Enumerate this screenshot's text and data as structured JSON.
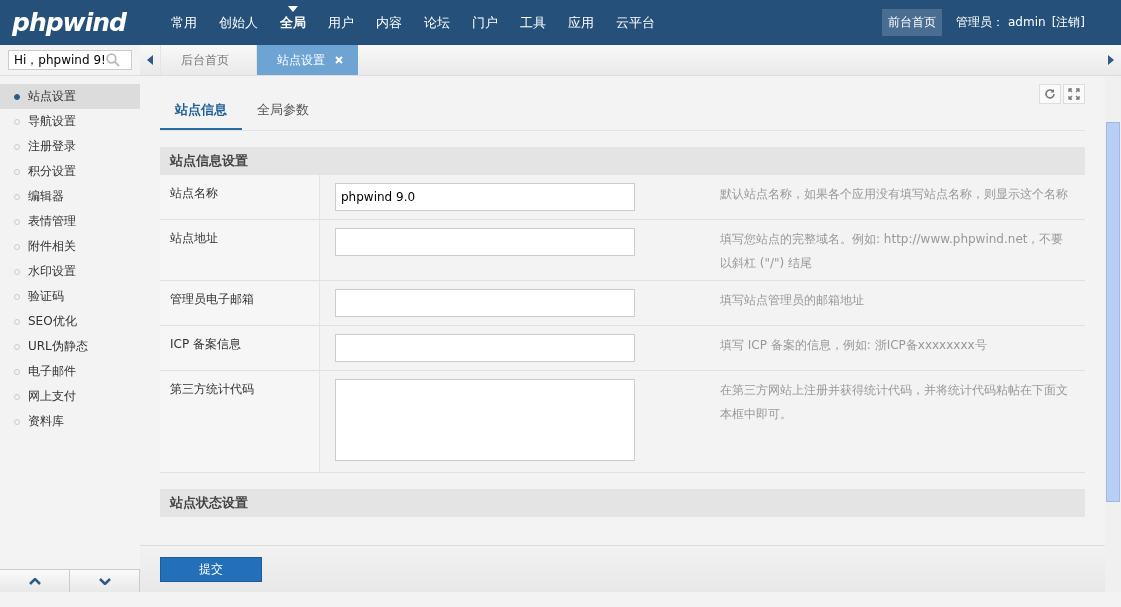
{
  "header": {
    "logo": "phpwind",
    "nav": [
      {
        "label": "常用",
        "selected": false
      },
      {
        "label": "创始人",
        "selected": false
      },
      {
        "label": "全局",
        "selected": true
      },
      {
        "label": "用户",
        "selected": false
      },
      {
        "label": "内容",
        "selected": false
      },
      {
        "label": "论坛",
        "selected": false
      },
      {
        "label": "门户",
        "selected": false
      },
      {
        "label": "工具",
        "selected": false
      },
      {
        "label": "应用",
        "selected": false
      },
      {
        "label": "云平台",
        "selected": false
      }
    ],
    "front_link": "前台首页",
    "admin_label": "管理员：",
    "admin_name": "admin",
    "logout": "[注销]"
  },
  "search": {
    "value": "Hi，phpwind 9!"
  },
  "page_tabs": [
    {
      "label": "后台首页",
      "selected": false,
      "closable": false
    },
    {
      "label": "站点设置",
      "selected": true,
      "closable": true
    }
  ],
  "sidebar": {
    "items": [
      {
        "label": "站点设置",
        "selected": true
      },
      {
        "label": "导航设置",
        "selected": false
      },
      {
        "label": "注册登录",
        "selected": false
      },
      {
        "label": "积分设置",
        "selected": false
      },
      {
        "label": "编辑器",
        "selected": false
      },
      {
        "label": "表情管理",
        "selected": false
      },
      {
        "label": "附件相关",
        "selected": false
      },
      {
        "label": "水印设置",
        "selected": false
      },
      {
        "label": "验证码",
        "selected": false
      },
      {
        "label": "SEO优化",
        "selected": false
      },
      {
        "label": "URL伪静态",
        "selected": false
      },
      {
        "label": "电子邮件",
        "selected": false
      },
      {
        "label": "网上支付",
        "selected": false
      },
      {
        "label": "资料库",
        "selected": false
      }
    ]
  },
  "content_tabs": [
    {
      "label": "站点信息",
      "selected": true
    },
    {
      "label": "全局参数",
      "selected": false
    }
  ],
  "sections": [
    {
      "title": "站点信息设置",
      "rows": [
        {
          "label": "站点名称",
          "kind": "input",
          "value": "phpwind 9.0",
          "hint": "默认站点名称，如果各个应用没有填写站点名称，则显示这个名称"
        },
        {
          "label": "站点地址",
          "kind": "input",
          "value": "",
          "hint": "填写您站点的完整域名。例如: http://www.phpwind.net，不要以斜杠 (\"/\") 结尾"
        },
        {
          "label": "管理员电子邮箱",
          "kind": "input",
          "value": "",
          "hint": "填写站点管理员的邮箱地址"
        },
        {
          "label": "ICP 备案信息",
          "kind": "input",
          "value": "",
          "hint": "填写 ICP 备案的信息，例如: 浙ICP备xxxxxxxx号"
        },
        {
          "label": "第三方统计代码",
          "kind": "textarea",
          "value": "",
          "hint": "在第三方网站上注册并获得统计代码，并将统计代码粘帖在下面文本框中即可。"
        }
      ]
    },
    {
      "title": "站点状态设置"
    }
  ],
  "submit": "提交"
}
